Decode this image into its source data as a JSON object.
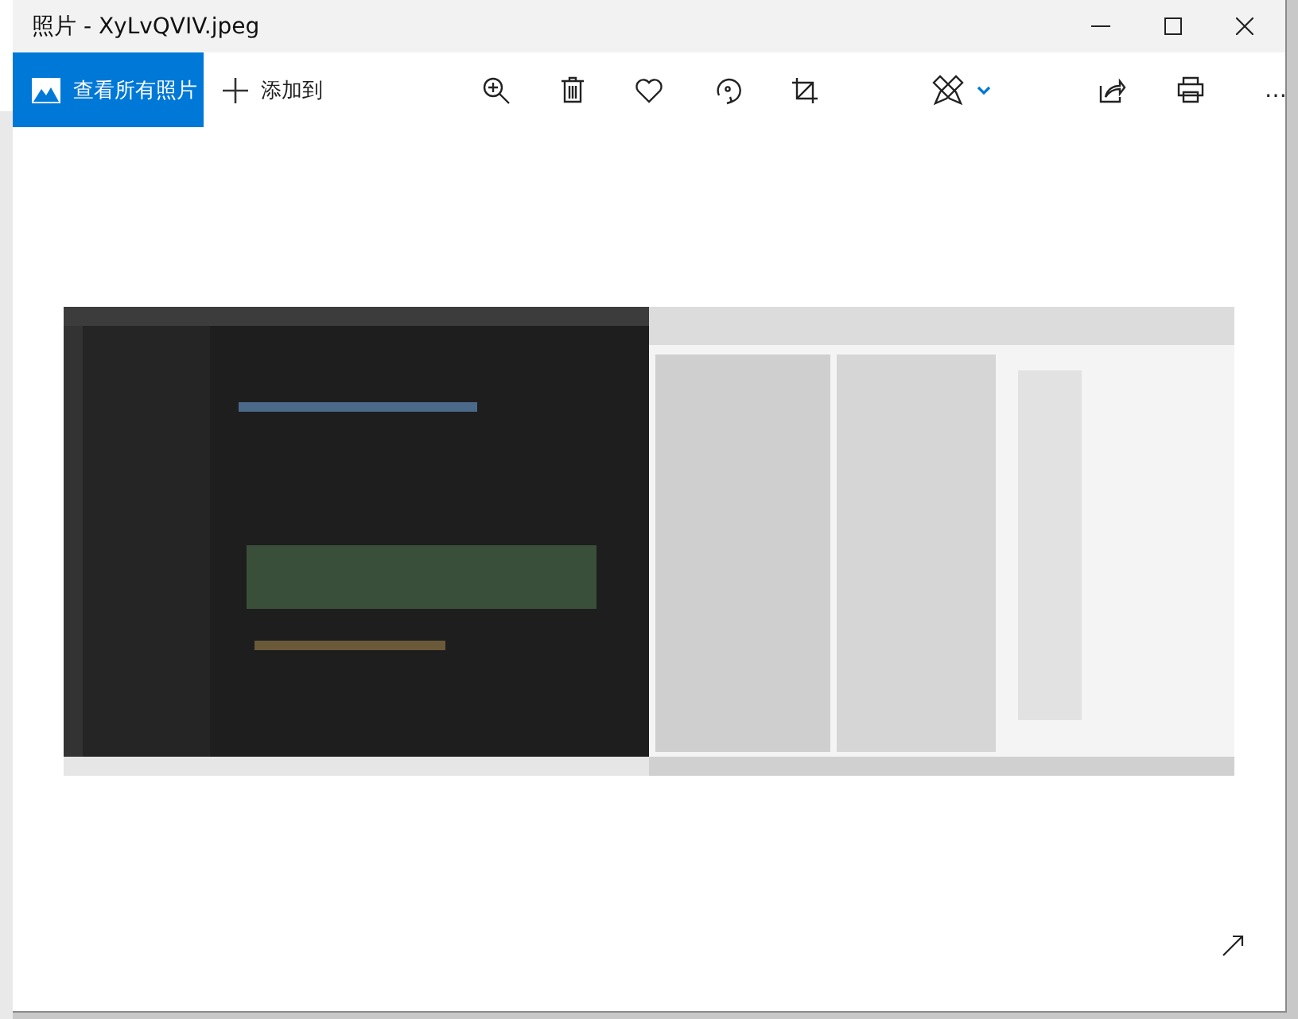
{
  "window": {
    "title": "照片 - XyLvQVIV.jpeg"
  },
  "toolbar": {
    "view_all": "查看所有照片",
    "add_to": "添加到",
    "more": "…"
  }
}
